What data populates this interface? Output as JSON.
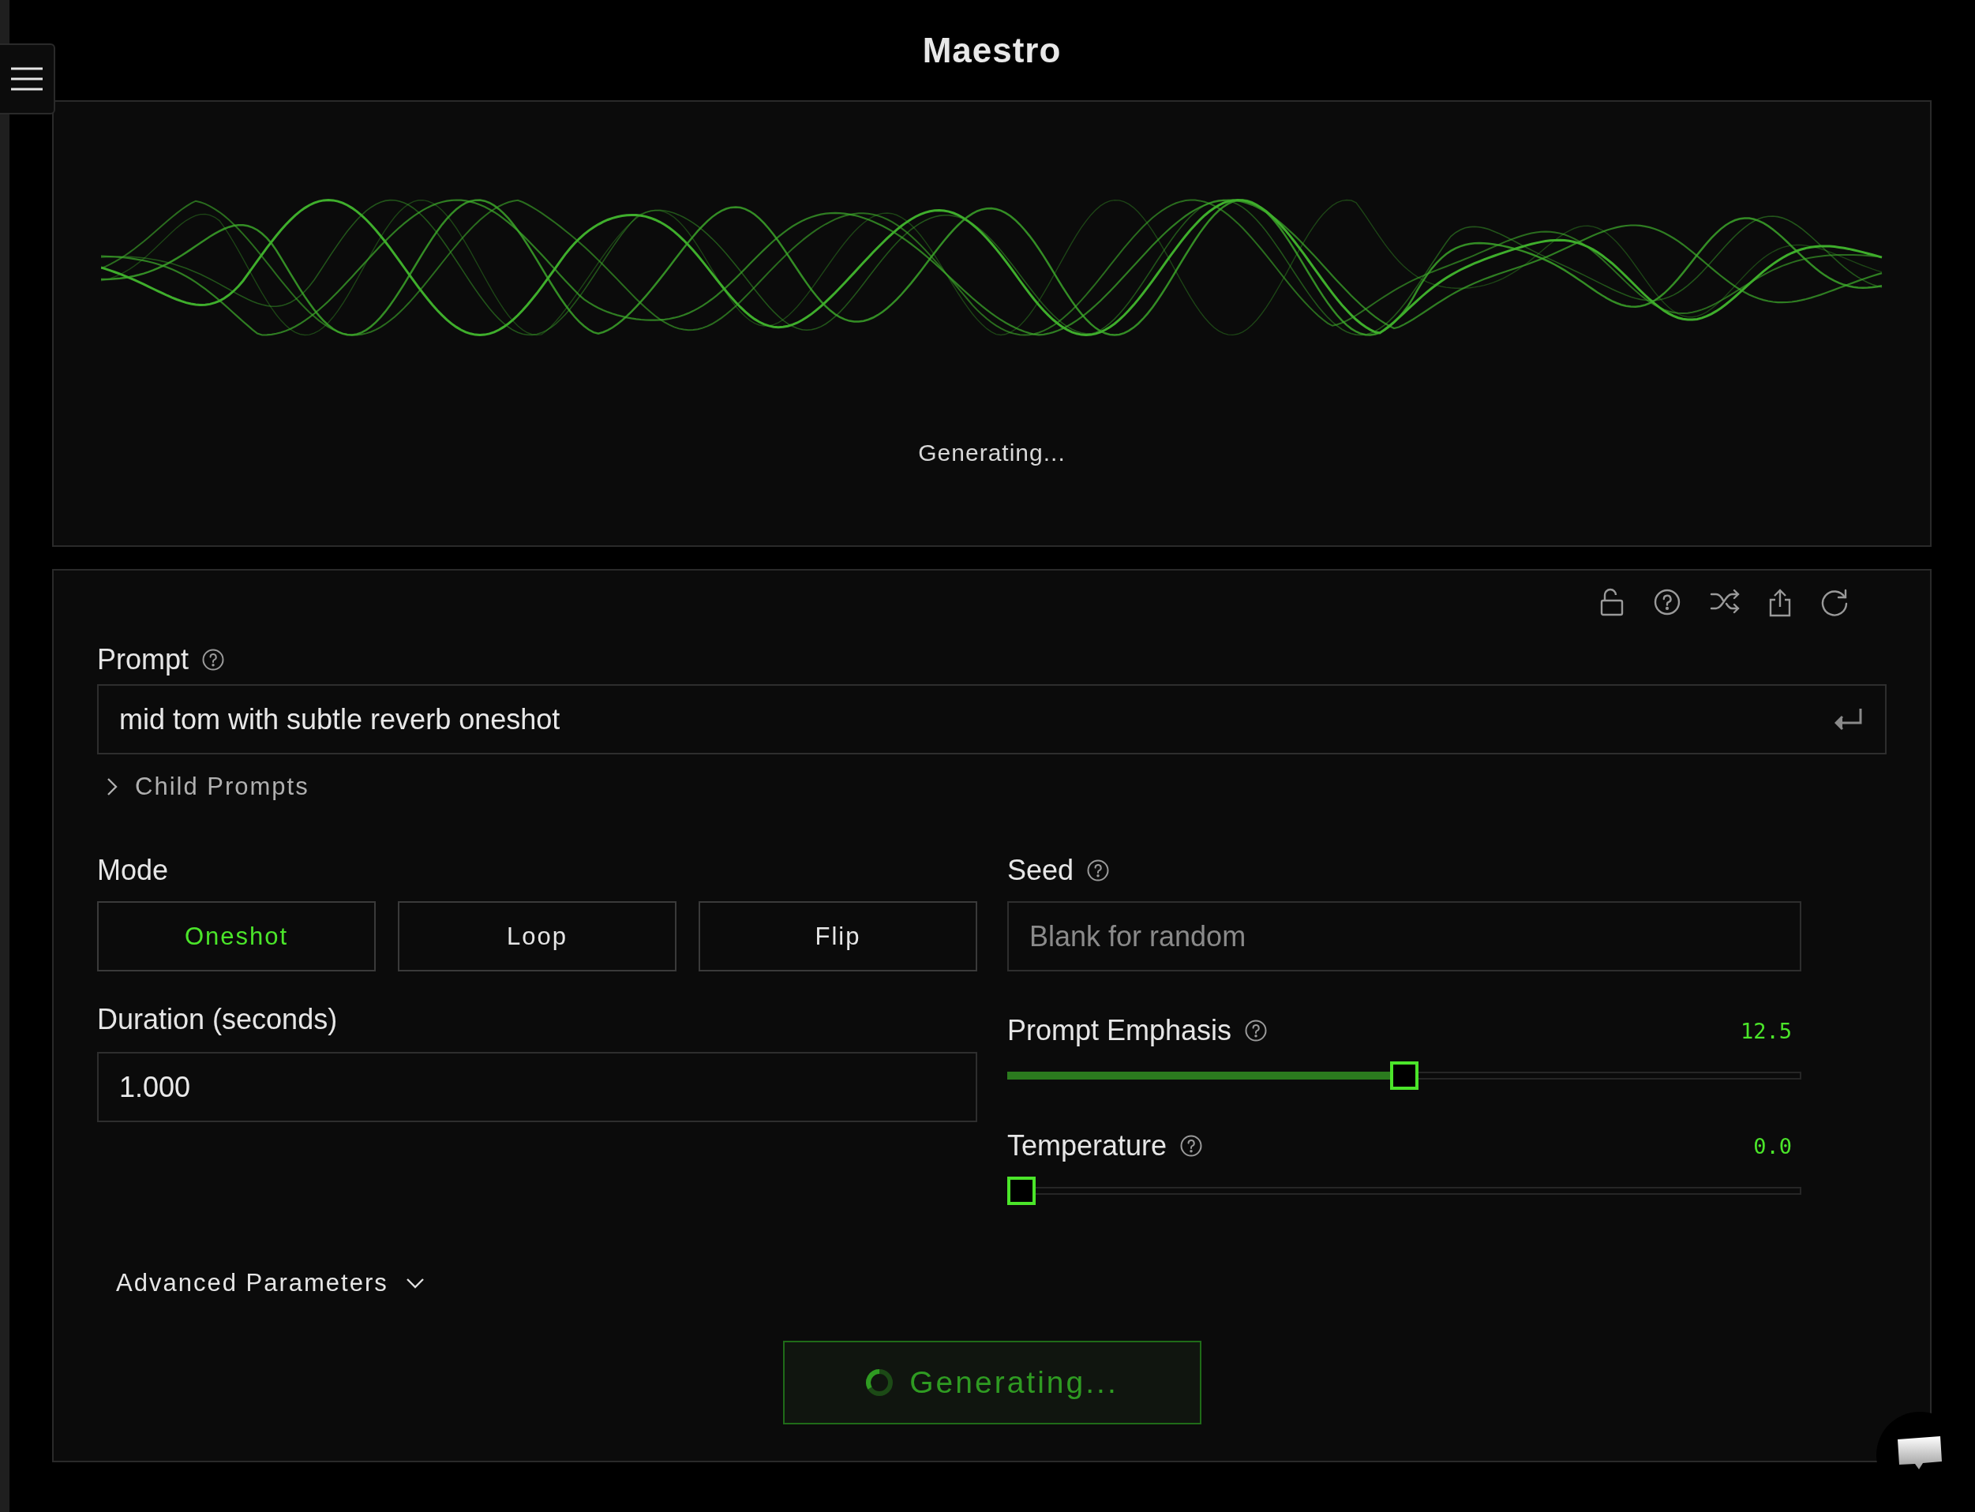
{
  "header": {
    "title": "Maestro"
  },
  "preview": {
    "status": "Generating..."
  },
  "prompt": {
    "label": "Prompt",
    "value": "mid tom with subtle reverb oneshot",
    "child_prompts": {
      "label": "Child Prompts",
      "expanded": false
    }
  },
  "mode": {
    "label": "Mode",
    "options": [
      {
        "label": "Oneshot",
        "selected": true
      },
      {
        "label": "Loop",
        "selected": false
      },
      {
        "label": "Flip",
        "selected": false
      }
    ]
  },
  "seed": {
    "label": "Seed",
    "placeholder": "Blank for random"
  },
  "duration": {
    "label": "Duration (seconds)",
    "value": "1.000"
  },
  "sliders": [
    {
      "label": "Prompt Emphasis",
      "reading": "12.5",
      "level": 0.5
    },
    {
      "label": "Temperature",
      "reading": "0.0",
      "level": 0
    }
  ],
  "advanced": {
    "label": "Advanced Parameters",
    "expanded": false
  },
  "generate": {
    "label": "Generating...",
    "busy": true
  }
}
